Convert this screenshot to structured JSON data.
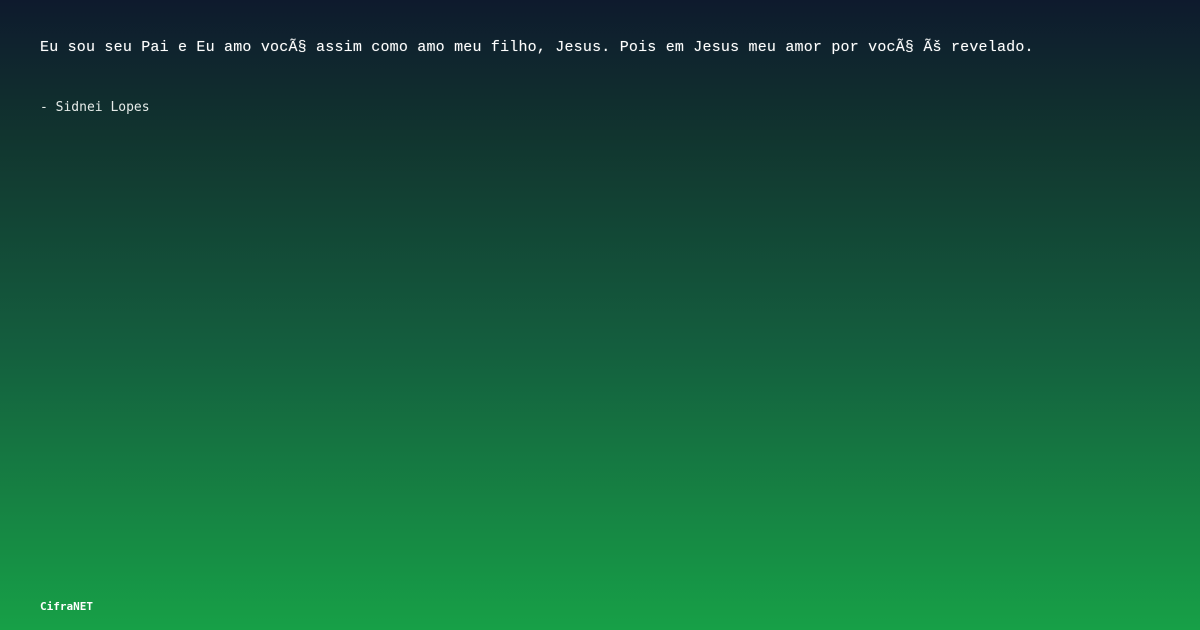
{
  "quote": {
    "text": "Eu sou seu Pai e Eu amo vocÃ§ assim como amo meu filho, Jesus. Pois em Jesus meu amor por vocÃ§ Ãš revelado.",
    "author": "- Sidnei Lopes"
  },
  "brand": {
    "name": "CifraNET"
  },
  "colors": {
    "background_top": "#0e1a2d",
    "background_bottom": "#17a047",
    "text": "#ffffff"
  }
}
